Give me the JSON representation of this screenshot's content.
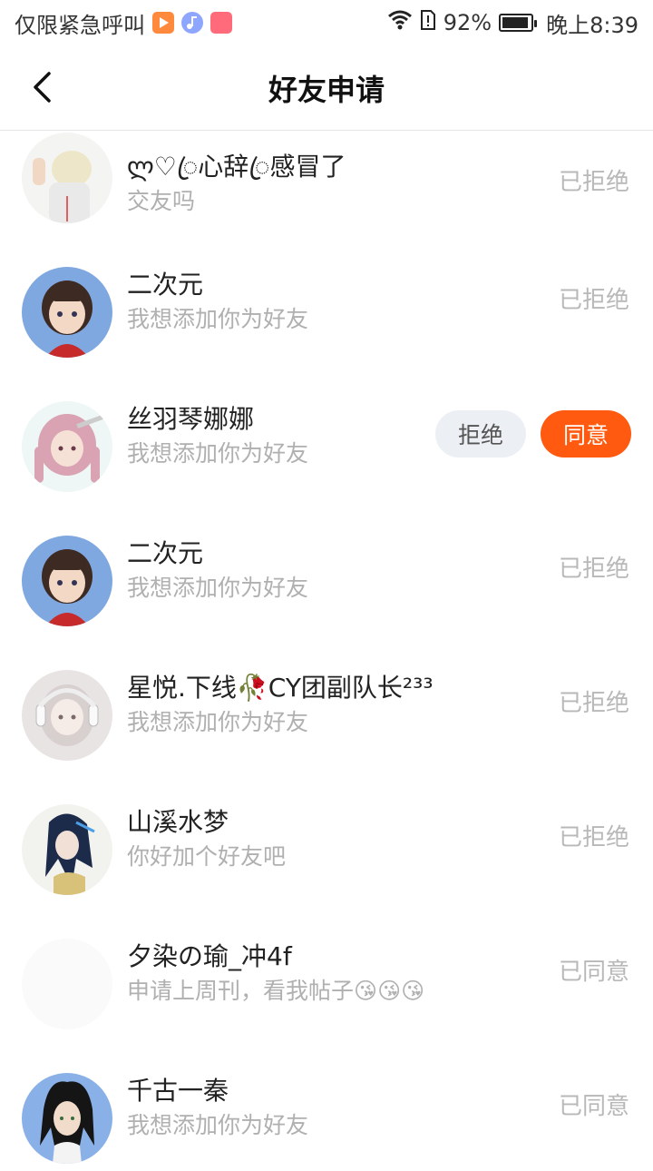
{
  "status_bar": {
    "carrier": "仅限紧急呼叫",
    "battery": "92%",
    "time": "晚上8:39",
    "app_icons": [
      "video-app-icon",
      "music-app-icon",
      "shop-app-icon"
    ]
  },
  "header": {
    "title": "好友申请",
    "back_icon": "chevron-left-icon"
  },
  "requests": [
    {
      "name": "ლ♡ꦿ心辞ꦿ感冒了",
      "message": "交友吗",
      "status": "已拒绝",
      "avatar": "avatar-anime-white-hair"
    },
    {
      "name": "二次元",
      "message": "我想添加你为好友",
      "status": "已拒绝",
      "avatar": "avatar-anime-girl-brown"
    },
    {
      "name": "丝羽琴娜娜",
      "message": "我想添加你为好友",
      "status": "",
      "reject_label": "拒绝",
      "agree_label": "同意",
      "avatar": "avatar-anime-pink-hair"
    },
    {
      "name": "二次元",
      "message": "我想添加你为好友",
      "status": "已拒绝",
      "avatar": "avatar-anime-girl-brown"
    },
    {
      "name": "星悦.下线🥀CY团副队长²³³",
      "message": "我想添加你为好友",
      "status": "已拒绝",
      "avatar": "avatar-doll-headphones"
    },
    {
      "name": "山溪水梦",
      "message": "你好加个好友吧",
      "status": "已拒绝",
      "avatar": "avatar-anime-dark-hair"
    },
    {
      "name": "夕染の瑜_冲4f",
      "message": "申请上周刊，看我帖子😘😘😘",
      "status": "已同意",
      "avatar": "avatar-blank"
    },
    {
      "name": "千古一秦",
      "message": "我想添加你为好友",
      "status": "已同意",
      "avatar": "avatar-anime-black-hair"
    }
  ],
  "colors": {
    "accent": "#ff5a10",
    "reject_bg": "#eceff4",
    "status_text": "#b8b8b8",
    "message_text": "#b0b0b0"
  }
}
